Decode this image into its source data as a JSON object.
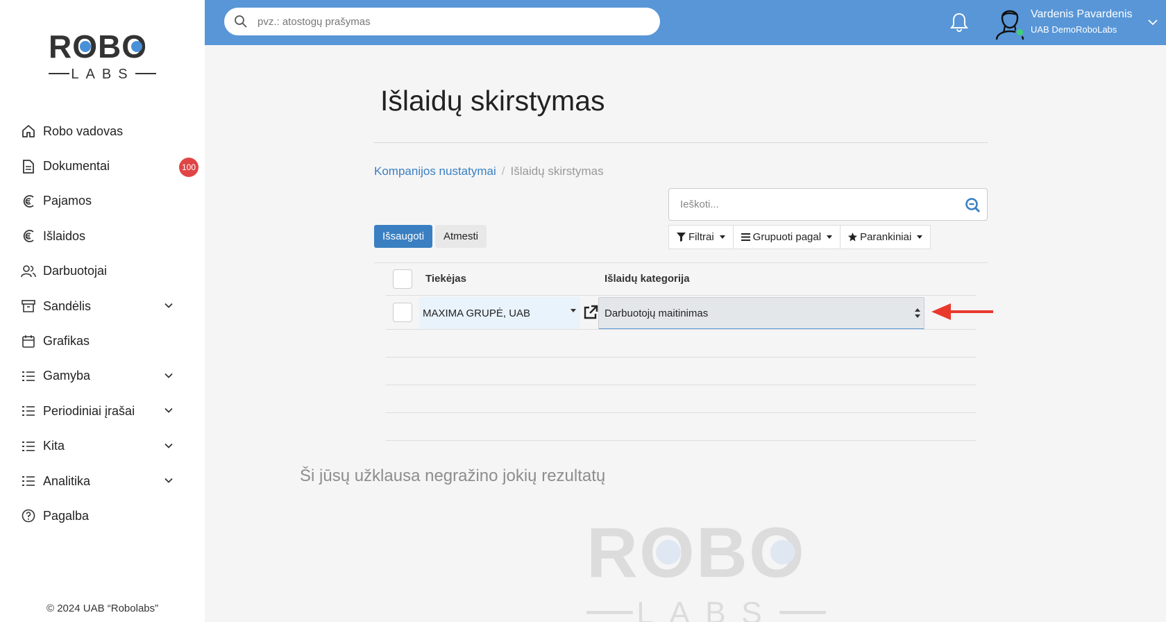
{
  "brand": {
    "logo_top": "ROBO",
    "logo_bottom": "LABS"
  },
  "search": {
    "placeholder": "pvz.: atostogų prašymas"
  },
  "user": {
    "name": "Vardenis Pavardenis",
    "company": "UAB DemoRoboLabs"
  },
  "sidebar": {
    "items": [
      {
        "label": "Robo vadovas",
        "icon": "home-icon"
      },
      {
        "label": "Dokumentai",
        "icon": "document-icon",
        "badge": "100"
      },
      {
        "label": "Pajamos",
        "icon": "euro-in-icon"
      },
      {
        "label": "Išlaidos",
        "icon": "euro-out-icon"
      },
      {
        "label": "Darbuotojai",
        "icon": "users-icon"
      },
      {
        "label": "Sandėlis",
        "icon": "archive-icon",
        "expandable": true
      },
      {
        "label": "Grafikas",
        "icon": "calendar-icon"
      },
      {
        "label": "Gamyba",
        "icon": "list-icon",
        "expandable": true
      },
      {
        "label": "Periodiniai įrašai",
        "icon": "list-icon",
        "expandable": true
      },
      {
        "label": "Kita",
        "icon": "list-icon",
        "expandable": true
      },
      {
        "label": "Analitika",
        "icon": "list-icon",
        "expandable": true
      },
      {
        "label": "Pagalba",
        "icon": "help-icon"
      }
    ],
    "copyright": "© 2024 UAB “Robolabs”"
  },
  "main": {
    "title": "Išlaidų skirstymas",
    "breadcrumb": {
      "link": "Kompanijos nustatymai",
      "separator": "/",
      "current": "Išlaidų skirstymas"
    },
    "search_placeholder": "Ieškoti...",
    "buttons": {
      "save": "Išsaugoti",
      "discard": "Atmesti"
    },
    "toolbar": {
      "filters": "Filtrai",
      "group_by": "Grupuoti pagal",
      "favorites": "Parankiniai"
    },
    "table": {
      "columns": [
        "Tiekėjas",
        "Išlaidų kategorija"
      ],
      "rows": [
        {
          "supplier": "MAXIMA GRUPĖ, UAB",
          "category": "Darbuotojų maitinimas"
        }
      ]
    },
    "empty_message": "Ši jūsų užklausa negražino jokių rezultatų"
  },
  "colors": {
    "topbar": "#5896d7",
    "primary": "#3a7fc1",
    "badge": "#e04545",
    "arrow": "#e8392c",
    "online": "#3bd16f"
  }
}
